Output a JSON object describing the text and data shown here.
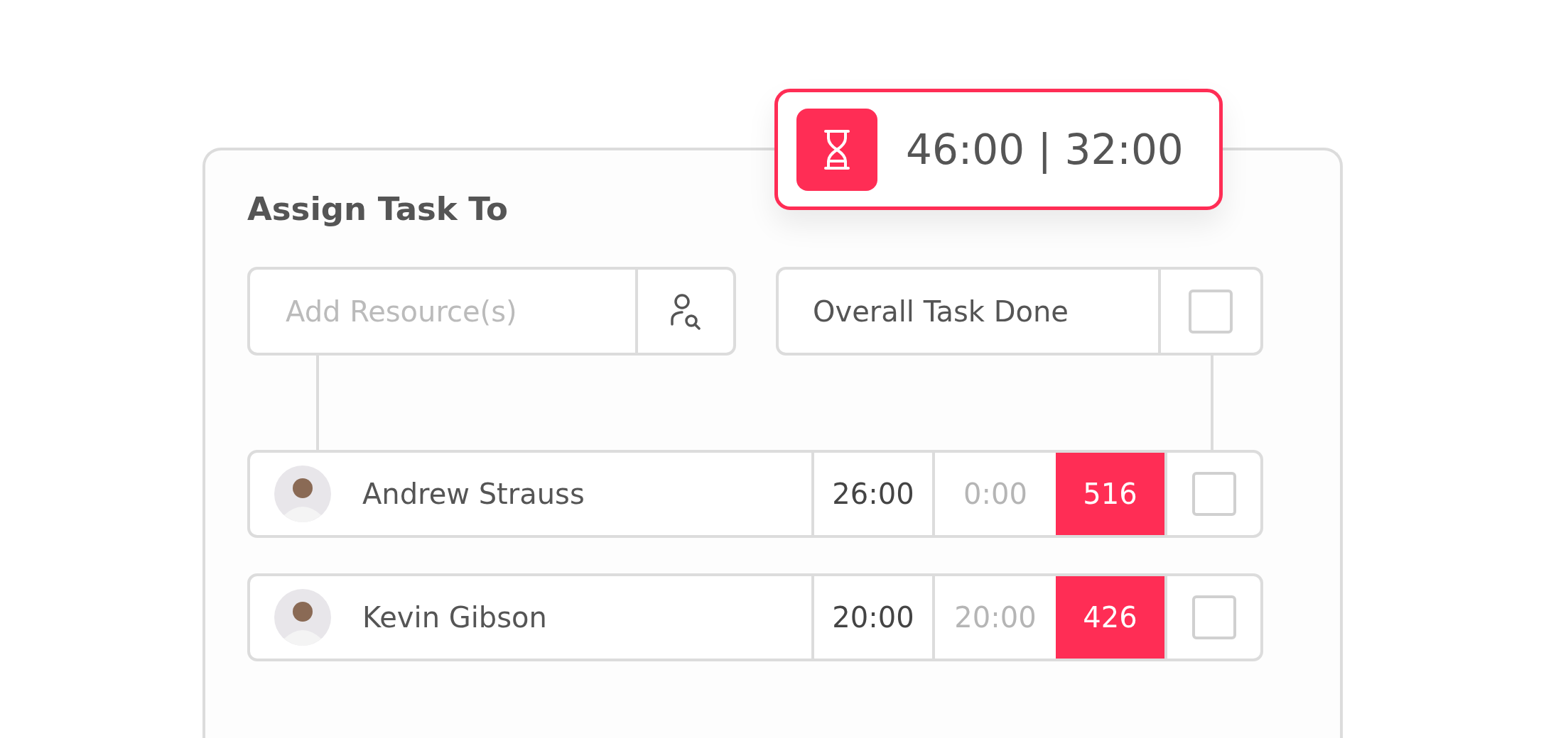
{
  "timer": {
    "text": "46:00 | 32:00"
  },
  "panel": {
    "title": "Assign Task To"
  },
  "resource_field": {
    "placeholder": "Add Resource(s)"
  },
  "overall": {
    "label": "Overall Task Done",
    "checked": false
  },
  "assignees": [
    {
      "name": "Andrew Strauss",
      "hours": "26:00",
      "done": "0:00",
      "score": "516",
      "checked": false
    },
    {
      "name": "Kevin Gibson",
      "hours": "20:00",
      "done": "20:00",
      "score": "426",
      "checked": false
    }
  ]
}
